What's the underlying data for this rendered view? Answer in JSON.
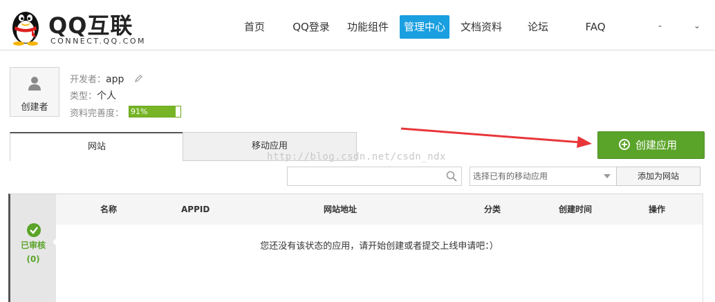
{
  "header": {
    "logo_title": "QQ互联",
    "logo_subtitle": "CONNECT.QQ.COM",
    "nav": [
      {
        "label": "首页",
        "active": false
      },
      {
        "label": "QQ登录",
        "active": false
      },
      {
        "label": "功能组件",
        "active": false
      },
      {
        "label": "管理中心",
        "active": true
      },
      {
        "label": "文档资料",
        "active": false
      },
      {
        "label": "论坛",
        "active": false
      },
      {
        "label": "FAQ",
        "active": false
      }
    ],
    "user_label": "-",
    "user_chevron": "⌄"
  },
  "profile": {
    "avatar_label": "创建者",
    "developer_label": "开发者：",
    "developer_value": "app",
    "type_label": "类型：",
    "type_value": "个人",
    "completeness_label": "资料完善度：",
    "completeness_text": "91%",
    "completeness_value": 0.91
  },
  "tabs": [
    {
      "label": "网站",
      "active": true
    },
    {
      "label": "移动应用",
      "active": false
    }
  ],
  "create_button_label": "创建应用",
  "watermark": "http://blog.csdn.net/csdn_ndx",
  "filters": {
    "search_value": "",
    "select_placeholder": "选择已有的移动应用",
    "add_button_label": "添加为网站"
  },
  "status_panel": {
    "label": "已审核",
    "count": "(0)"
  },
  "table": {
    "columns": [
      "名称",
      "APPID",
      "网站地址",
      "分类",
      "创建时间",
      "操作"
    ],
    "empty_message": "您还没有该状态的应用，请开始创建或者提交上线申请吧：）"
  },
  "colors": {
    "accent_blue": "#1a9fe0",
    "success_green": "#5ba42a",
    "arrow_red": "#e8363a"
  }
}
